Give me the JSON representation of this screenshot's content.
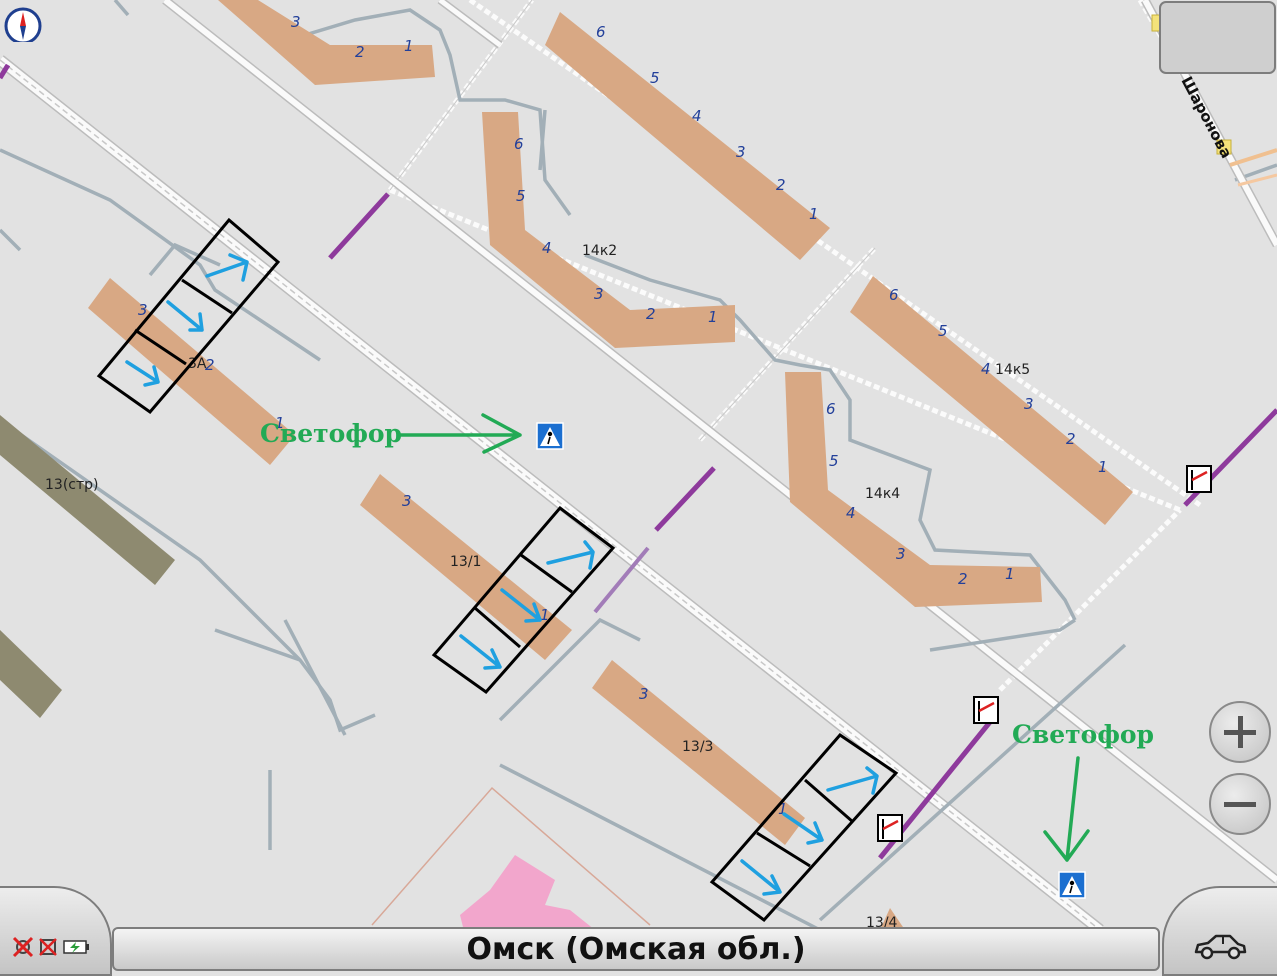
{
  "location": {
    "name": "Омск (Омская обл.)"
  },
  "street_name": "Шаронова",
  "annotations": {
    "traffic_light_1": "Светофор",
    "traffic_light_2": "Светофор"
  },
  "building_labels": {
    "b14k2": "14к2",
    "b14k5": "14к5",
    "b14k4": "14к4",
    "b13_1": "13/1",
    "b13_3": "13/3",
    "b13_4": "13/4",
    "b13str": "13(стр)",
    "b3a": "3А"
  },
  "entrance_numbers": {
    "topleft": [
      "3",
      "2",
      "1"
    ],
    "top": [
      "6",
      "5",
      "4",
      "3",
      "2",
      "1"
    ],
    "k2": [
      "6",
      "5",
      "4",
      "3",
      "2",
      "1"
    ],
    "k5": [
      "6",
      "5",
      "4",
      "3",
      "2",
      "1"
    ],
    "k4": [
      "6",
      "5",
      "4",
      "3",
      "2",
      "1"
    ],
    "b3a": [
      "3",
      "2",
      "1"
    ],
    "b13_1": [
      "3",
      "1"
    ],
    "b13_3": [
      "3",
      "1"
    ]
  },
  "icons": {
    "compass": "compass-icon",
    "zoom_in": "zoom-in-icon",
    "zoom_out": "zoom-out-icon",
    "vehicle": "car-icon",
    "gps_off": "gps-off-icon",
    "signal_off": "signal-off-icon",
    "battery": "battery-charging-icon",
    "crossing": "pedestrian-crossing-icon",
    "barrier": "barrier-icon"
  },
  "colors": {
    "map_bg": "#e2e2e2",
    "building": "#d8a884",
    "road_outline": "#a0adb4",
    "purple_path": "#8e3a9c",
    "annotation_green": "#22aa55",
    "arrow_blue": "#1fa0e0",
    "crossing_blue": "#1b6fd0",
    "pink_area": "#f2a6cc",
    "industrial": "#8e8a70"
  }
}
